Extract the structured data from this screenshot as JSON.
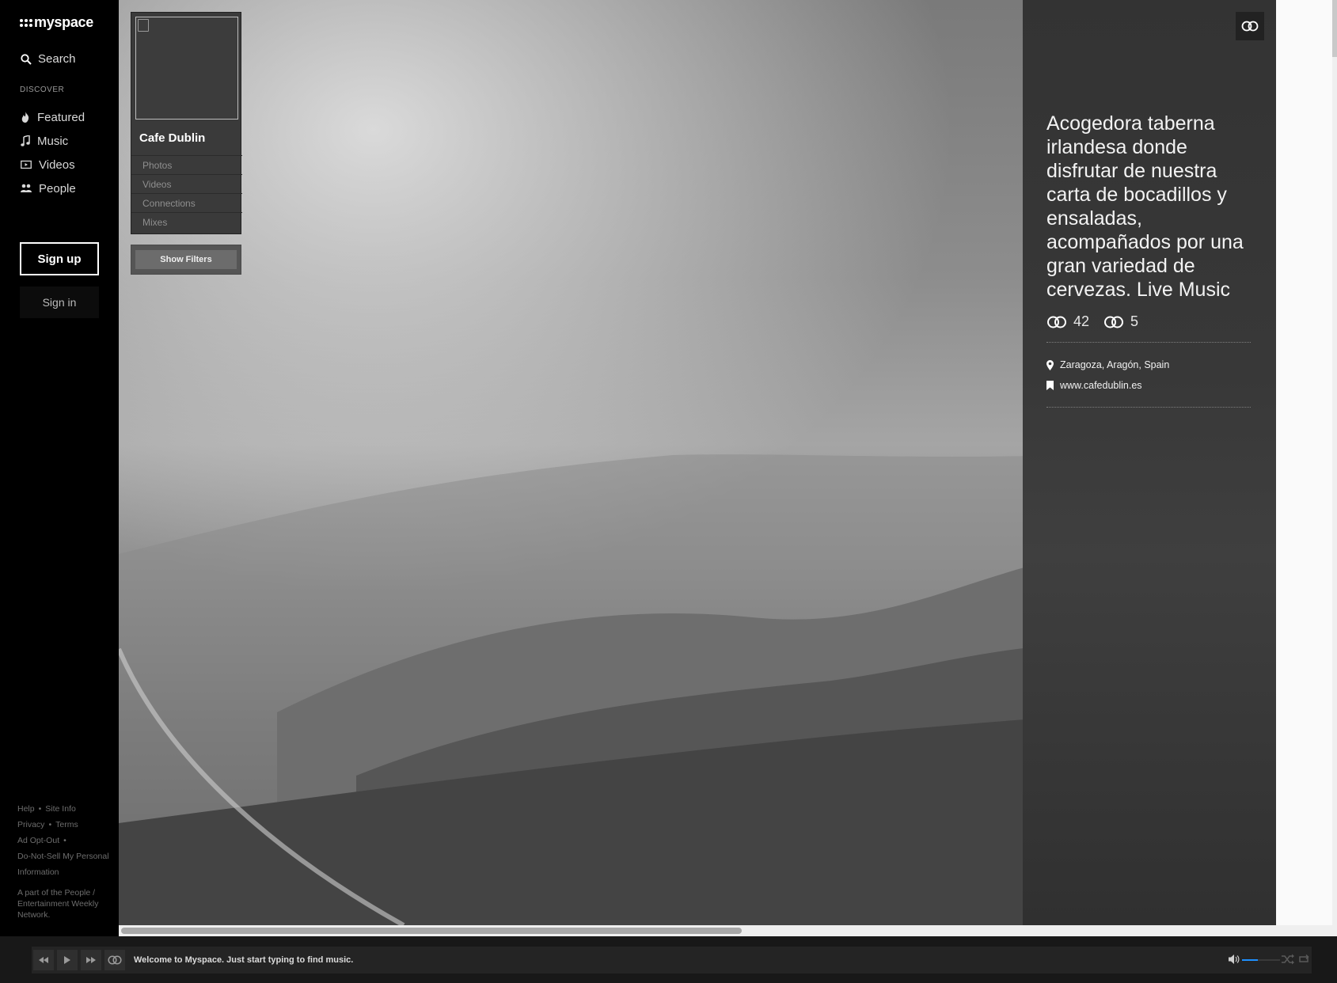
{
  "brand": {
    "name": "myspace"
  },
  "nav": {
    "search_label": "Search",
    "discover_heading": "DISCOVER",
    "items": [
      {
        "label": "Featured",
        "icon": "flame-icon"
      },
      {
        "label": "Music",
        "icon": "music-note-icon"
      },
      {
        "label": "Videos",
        "icon": "video-icon"
      },
      {
        "label": "People",
        "icon": "people-icon"
      }
    ],
    "signup_label": "Sign up",
    "signin_label": "Sign in"
  },
  "footer": {
    "links": [
      "Help",
      "Site Info",
      "Privacy",
      "Terms",
      "Ad Opt-Out",
      "Do-Not-Sell My Personal Information"
    ],
    "network_text": "A part of the People / Entertainment Weekly Network."
  },
  "profile": {
    "name": "Cafe Dublin",
    "tabs": [
      "Photos",
      "Videos",
      "Connections",
      "Mixes"
    ],
    "filters_label": "Show Filters",
    "description": "Acogedora taberna irlandesa donde disfrutar de nuestra carta de bocadillos y ensaladas, acompañados por una gran variedad de cervezas. Live Music",
    "stats": {
      "connections": "42",
      "connected_to": "5"
    },
    "location": "Zaragoza, Aragón, Spain",
    "website": "www.cafedublin.es"
  },
  "player": {
    "message": "Welcome to Myspace. Just start typing to find music.",
    "volume_level": 0.42
  },
  "colors": {
    "sidebar_bg": "#000000",
    "panel_bg": "#383838",
    "player_bg": "#181818",
    "volume_accent": "#1e90ff"
  }
}
